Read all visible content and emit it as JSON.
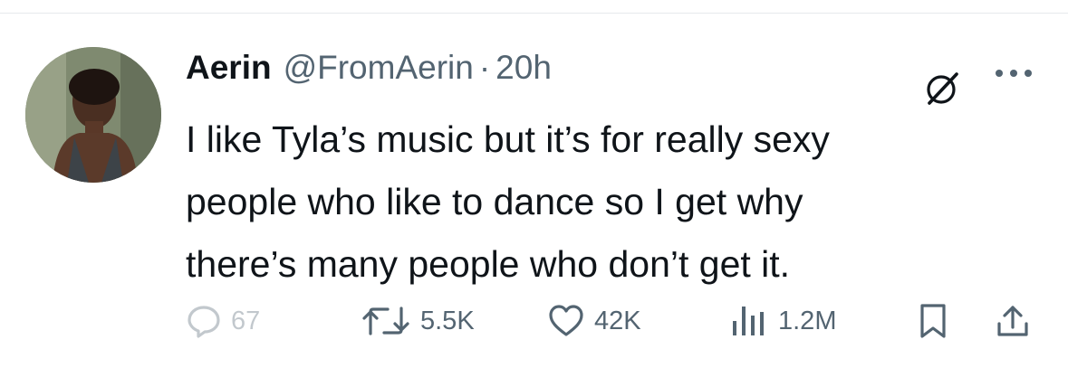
{
  "tweet": {
    "author_name": "Aerin",
    "author_handle": "@FromAerin",
    "separator": "·",
    "timestamp": "20h",
    "text": "I like Tyla’s music but it’s for really sexy\npeople who like to dance so I get why\nthere’s many people who don’t get it."
  },
  "actions": {
    "replies": "67",
    "reposts": "5.5K",
    "likes": "42K",
    "views": "1.2M"
  },
  "icons": {
    "reply": "reply-icon",
    "repost": "repost-icon",
    "like": "heart-icon",
    "views": "views-icon",
    "bookmark": "bookmark-icon",
    "share": "share-icon",
    "grok": "grok-icon",
    "more": "more-icon"
  },
  "colors": {
    "text": "#0f1419",
    "muted": "#536471",
    "divider": "#e6e9ec"
  }
}
